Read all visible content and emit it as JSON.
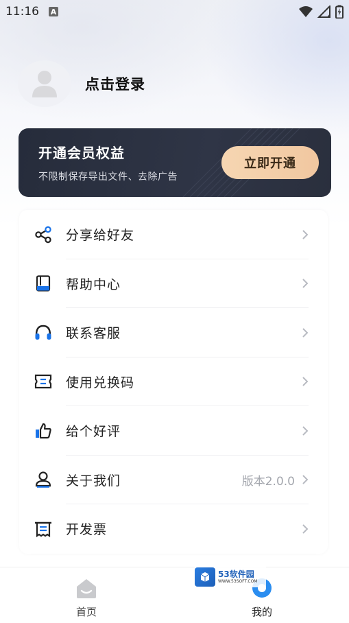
{
  "status_bar": {
    "time": "11:16",
    "notification_badge": "A",
    "icons": [
      "wifi-icon",
      "signal-icon",
      "battery-icon"
    ]
  },
  "profile": {
    "login_text": "点击登录"
  },
  "vip": {
    "title": "开通会员权益",
    "subtitle": "不限制保存导出文件、去除广告",
    "button_label": "立即开通"
  },
  "menu": {
    "items": [
      {
        "icon": "share-icon",
        "label": "分享给好友",
        "extra": ""
      },
      {
        "icon": "book-icon",
        "label": "帮助中心",
        "extra": ""
      },
      {
        "icon": "headset-icon",
        "label": "联系客服",
        "extra": ""
      },
      {
        "icon": "ticket-icon",
        "label": "使用兑换码",
        "extra": ""
      },
      {
        "icon": "thumbs-up-icon",
        "label": "给个好评",
        "extra": ""
      },
      {
        "icon": "user-icon",
        "label": "关于我们",
        "extra": "版本2.0.0"
      },
      {
        "icon": "invoice-icon",
        "label": "开发票",
        "extra": ""
      }
    ]
  },
  "tab_bar": {
    "tabs": [
      {
        "label": "首页",
        "icon": "home-icon",
        "active": false
      },
      {
        "label": "我的",
        "icon": "profile-tab-icon",
        "active": true
      }
    ]
  },
  "watermark": {
    "brand": "53软件园",
    "url": "WWW.53SOFT.COM"
  },
  "colors": {
    "accent_blue": "#1a73e8",
    "vip_card_bg": "#2b3040",
    "vip_button": "#f4d0aa",
    "chevron": "#b8bbc2"
  }
}
